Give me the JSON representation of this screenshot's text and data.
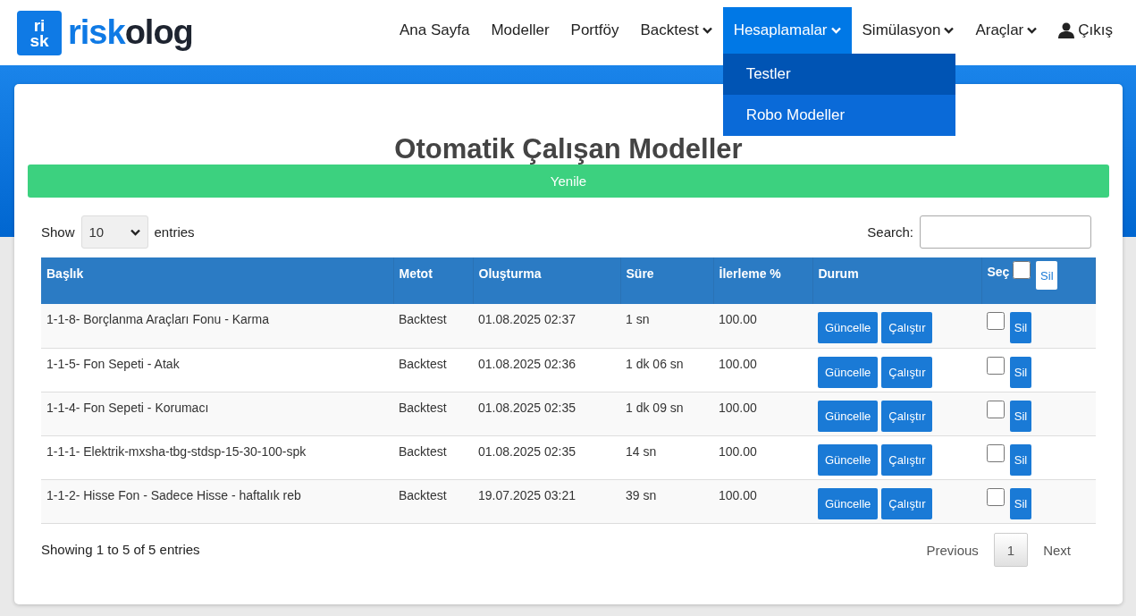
{
  "logo": {
    "mark_top": "ri",
    "mark_bottom": "sk",
    "wordmark_accent": "risk",
    "wordmark_rest": "olog"
  },
  "nav": [
    {
      "label": "Ana Sayfa",
      "has_menu": false,
      "selected": false,
      "kind": "link"
    },
    {
      "label": "Modeller",
      "has_menu": false,
      "selected": false,
      "kind": "link"
    },
    {
      "label": "Portföy",
      "has_menu": false,
      "selected": false,
      "kind": "link"
    },
    {
      "label": "Backtest",
      "has_menu": true,
      "selected": false,
      "kind": "link"
    },
    {
      "label": "Hesaplamalar",
      "has_menu": true,
      "selected": true,
      "kind": "link",
      "menu": [
        {
          "label": "Testler",
          "selected": true
        },
        {
          "label": "Robo Modeller",
          "selected": false
        }
      ]
    },
    {
      "label": "Simülasyon",
      "has_menu": true,
      "selected": false,
      "kind": "link"
    },
    {
      "label": "Araçlar",
      "has_menu": true,
      "selected": false,
      "kind": "link"
    },
    {
      "label": "Çıkış",
      "has_menu": false,
      "selected": false,
      "kind": "user"
    }
  ],
  "page_title": "Otomatik Çalışan Modeller",
  "refresh_button": "Yenile",
  "length": {
    "show": "Show",
    "value": "10",
    "entries": "entries"
  },
  "search": {
    "label": "Search:"
  },
  "table": {
    "columns": [
      "Başlık",
      "Metot",
      "Oluşturma",
      "Süre",
      "İlerleme %",
      "Durum"
    ],
    "select_column": {
      "label": "Seç",
      "checked": false,
      "delete": "Sil"
    },
    "rows": [
      {
        "cells": [
          "1-1-8- Borçlanma Araçları Fonu - Karma",
          "Backtest",
          "01.08.2025 02:37",
          "1 sn",
          "100.00"
        ],
        "actions": [
          "Güncelle",
          "Çalıştır"
        ],
        "checked": false,
        "delete": "Sil"
      },
      {
        "cells": [
          "1-1-5- Fon Sepeti - Atak",
          "Backtest",
          "01.08.2025 02:36",
          "1 dk 06 sn",
          "100.00"
        ],
        "actions": [
          "Güncelle",
          "Çalıştır"
        ],
        "checked": false,
        "delete": "Sil"
      },
      {
        "cells": [
          "1-1-4- Fon Sepeti - Korumacı",
          "Backtest",
          "01.08.2025 02:35",
          "1 dk 09 sn",
          "100.00"
        ],
        "actions": [
          "Güncelle",
          "Çalıştır"
        ],
        "checked": false,
        "delete": "Sil"
      },
      {
        "cells": [
          "1-1-1- Elektrik-mxsha-tbg-stdsp-15-30-100-spk",
          "Backtest",
          "01.08.2025 02:35",
          "14 sn",
          "100.00"
        ],
        "actions": [
          "Güncelle",
          "Çalıştır"
        ],
        "checked": false,
        "delete": "Sil"
      },
      {
        "cells": [
          "1-1-2- Hisse Fon - Sadece Hisse - haftalık reb",
          "Backtest",
          "19.07.2025 03:21",
          "39 sn",
          "100.00"
        ],
        "actions": [
          "Güncelle",
          "Çalıştır"
        ],
        "checked": false,
        "delete": "Sil"
      }
    ]
  },
  "footer": {
    "info": "Showing 1 to 5 of 5 entries",
    "pages": [
      {
        "label": "Previous",
        "selected": false
      },
      {
        "label": "1",
        "selected": true
      },
      {
        "label": "Next",
        "selected": false
      }
    ]
  }
}
